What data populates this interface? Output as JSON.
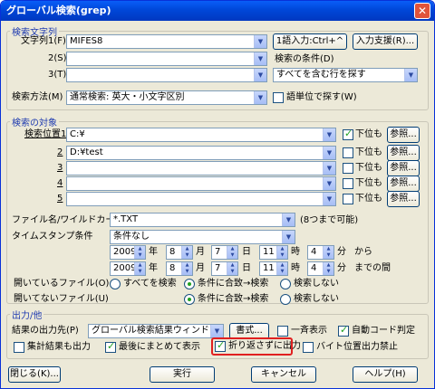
{
  "window": {
    "title": "グローバル検索(grep)",
    "close_glyph": "✕"
  },
  "search_string": {
    "group_title": "検索文字列",
    "label1": "文字列1(F)",
    "value1": "MIFES8",
    "label2": "2(S)",
    "value2": "",
    "label3": "3(T)",
    "value3": "",
    "input1_button": "1語入力:Ctrl+^",
    "assist_button": "入力支援(R)...",
    "condition_label": "検索の条件(D)",
    "condition_value": "すべてを含む行を探す",
    "method_label": "検索方法(M)",
    "method_value": "通常検索: 英大・小文字区別",
    "word_unit_label": "語単位で探す(W)"
  },
  "search_target": {
    "group_title": "検索の対象",
    "rows": [
      {
        "label": "検索位置1",
        "value": "C:¥",
        "sub": "下位も",
        "sub_checked": true,
        "browse": "参照..."
      },
      {
        "label": "2",
        "value": "D:¥test",
        "sub": "下位も",
        "sub_checked": false,
        "browse": "参照..."
      },
      {
        "label": "3",
        "value": "",
        "sub": "下位も",
        "sub_checked": false,
        "browse": "参照..."
      },
      {
        "label": "4",
        "value": "",
        "sub": "下位も",
        "sub_checked": false,
        "browse": "参照..."
      },
      {
        "label": "5",
        "value": "",
        "sub": "下位も",
        "sub_checked": false,
        "browse": "参照..."
      }
    ],
    "filename_label": "ファイル名/ワイルドカード(N)",
    "filename_value": "*.TXT",
    "filename_note": "(8つまで可能)",
    "timestamp_label": "タイムスタンプ条件",
    "timestamp_value": "条件なし",
    "date_from": {
      "year": "2009",
      "y": "年",
      "month": "8",
      "m": "月",
      "day": "7",
      "d": "日",
      "hour": "11",
      "h": "時",
      "min": "4",
      "mm": "分",
      "suffix": "から"
    },
    "date_to": {
      "year": "2009",
      "y": "年",
      "month": "8",
      "m": "月",
      "day": "7",
      "d": "日",
      "hour": "11",
      "h": "時",
      "min": "4",
      "mm": "分",
      "suffix": "までの間"
    },
    "open_files_label": "開いているファイル(O)",
    "closed_files_label": "開いてないファイル(U)",
    "opt_all": "すべてを検索",
    "opt_cond": "条件に合致→検索",
    "opt_none": "検索しない"
  },
  "output": {
    "group_title": "出力/他",
    "dest_label": "結果の出力先(P)",
    "dest_value": "グローバル検索結果ウィンドウ",
    "format_button": "書式...",
    "batch_label": "一斉表示",
    "autocode_label": "自動コード判定",
    "aggregate_label": "集計結果も出力",
    "last_label": "最後にまとめて表示",
    "nowrap_label": "折り返さずに出力",
    "byte_label": "バイト位置出力禁止"
  },
  "buttons": {
    "close": "閉じる(K)...",
    "run": "実行",
    "cancel": "キャンセル",
    "help": "ヘルプ(H)"
  },
  "colors": {
    "accent": "#1f3bb0",
    "highlight": "#e02020",
    "titlebar": "#0047d8"
  }
}
